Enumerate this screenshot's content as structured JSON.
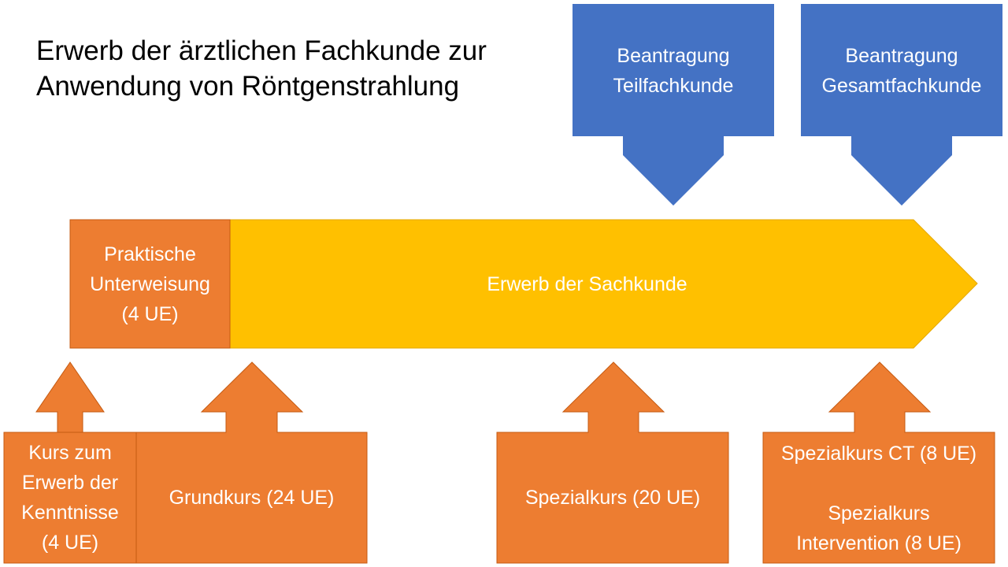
{
  "title": {
    "line1": "Erwerb der ärztlichen Fachkunde zur",
    "line2": "Anwendung von Röntgenstrahlung"
  },
  "colors": {
    "orange": "#ED7D31",
    "yellow": "#FFC000",
    "blue": "#4472C4",
    "text": "#FFFFFF"
  },
  "applications": [
    {
      "line1": "Beantragung",
      "line2": "Teilfachkunde"
    },
    {
      "line1": "Beantragung",
      "line2": "Gesamtfachkunde"
    }
  ],
  "main_bar": {
    "practical": {
      "line1": "Praktische",
      "line2": "Unterweisung",
      "line3": "(4 UE)"
    },
    "sachkunde": "Erwerb der Sachkunde"
  },
  "courses": {
    "kenntnisse": {
      "line1": "Kurs zum",
      "line2": "Erwerb der",
      "line3": "Kenntnisse",
      "line4": "(4 UE)"
    },
    "grundkurs": "Grundkurs (24 UE)",
    "spezialkurs": "Spezialkurs (20 UE)",
    "spezial_ct": "Spezialkurs CT (8 UE)",
    "spezial_intervention": {
      "line1": "Spezialkurs",
      "line2": "Intervention (8 UE)"
    }
  }
}
